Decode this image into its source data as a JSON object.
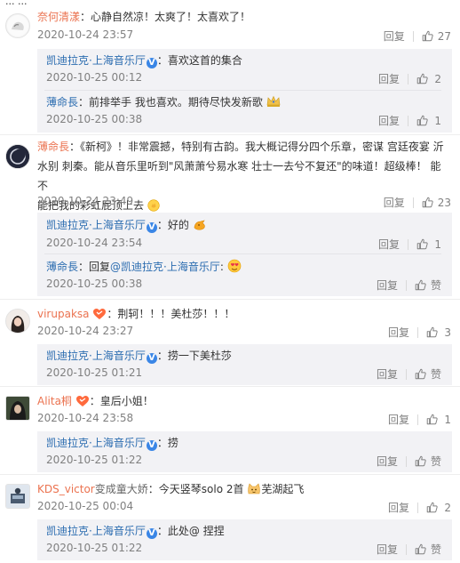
{
  "top_fragment": "... ...",
  "official": {
    "name": "凯迪拉克·上海音乐厅"
  },
  "labels": {
    "reply": "回复",
    "like_zan": "赞"
  },
  "comments": [
    {
      "user": "奈何清漾",
      "text": "：心静自然凉！太爽了！太喜欢了！",
      "time": "2020-10-24 23:57",
      "likes": "27",
      "replies": [
        {
          "text": "：喜欢这首的集合",
          "time": "2020-10-25 00:12",
          "likes": "2"
        },
        {
          "user": "薄命長",
          "text": "：前排举手 我也喜欢。期待尽快发新歌",
          "time": "2020-10-25 00:38",
          "likes": "1"
        }
      ]
    },
    {
      "user": "薄命長",
      "text_line1": "：《新柯》！非常震撼，特别有古韵。我大概记得分四个乐章，密谋 宫廷夜宴 沂",
      "text_line2": "水别 刺秦。能从音乐里听到\"风萧萧兮易水寒 壮士一去兮不复还\"的味道！超级棒！ 能不",
      "text_line3": "能把我的彩虹屁顶上去",
      "time": "2020-10-24 23:49",
      "likes": "23",
      "replies": [
        {
          "text": "：好的",
          "time": "2020-10-24 23:54",
          "likes": "1"
        },
        {
          "user": "薄命長",
          "text_prefix": "：回复",
          "mention": "@凯迪拉克·上海音乐厅",
          "text_suffix": ":",
          "time": "2020-10-25 00:38",
          "likes": "赞"
        }
      ]
    },
    {
      "user": "virupaksa",
      "text": "：荆轲！！！美杜莎！！！",
      "time": "2020-10-24 23:27",
      "likes": "3",
      "replies": [
        {
          "text": "：捞一下美杜莎",
          "time": "2020-10-25 01:21",
          "likes": "赞"
        }
      ]
    },
    {
      "user": "Alita桐",
      "text": "：皇后小姐！",
      "time": "2020-10-24 23:58",
      "likes": "1",
      "replies": [
        {
          "text": "：捞",
          "time": "2020-10-25 01:22",
          "likes": "赞"
        }
      ]
    },
    {
      "user": "KDS_victor",
      "user_suffix": "变成童大娇",
      "text_a": "：今天竖琴solo 2首",
      "text_b": "芜湖起飞",
      "time": "2020-10-25 00:04",
      "likes": "2",
      "replies": [
        {
          "text": "：此处@ 捏捏",
          "time": "2020-10-25 01:22",
          "likes": "赞"
        }
      ]
    }
  ],
  "colors": {
    "username": "#eb7350",
    "official": "#2b6cb0",
    "reply_bg": "#f2f2f5",
    "meta": "#808080"
  }
}
